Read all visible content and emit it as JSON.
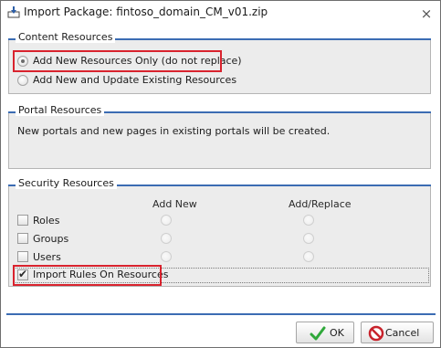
{
  "window": {
    "title": "Import Package: fintoso_domain_CM_v01.zip",
    "close_symbol": "×"
  },
  "content_resources": {
    "title": "Content Resources",
    "options": [
      {
        "label": "Add New Resources Only (do not replace)",
        "selected": true
      },
      {
        "label": "Add New and Update Existing Resources",
        "selected": false
      }
    ]
  },
  "portal_resources": {
    "title": "Portal Resources",
    "message": "New portals and new pages in existing portals will be created."
  },
  "security_resources": {
    "title": "Security Resources",
    "columns": [
      "Add New",
      "Add/Replace"
    ],
    "rows": [
      {
        "label": "Roles",
        "checked": false
      },
      {
        "label": "Groups",
        "checked": false
      },
      {
        "label": "Users",
        "checked": false
      }
    ],
    "import_rules": {
      "label": "Import Rules On Resources",
      "checked": true
    }
  },
  "buttons": {
    "ok": "OK",
    "cancel": "Cancel"
  },
  "icons": {
    "window": "import-package-icon",
    "ok": "green-check-icon",
    "cancel": "red-no-icon"
  },
  "colors": {
    "accent": "#3b6cb3",
    "highlight": "#d9232e",
    "group_bg": "#ececec",
    "ok_check": "#2fa83a",
    "cancel_red": "#c8232c"
  }
}
